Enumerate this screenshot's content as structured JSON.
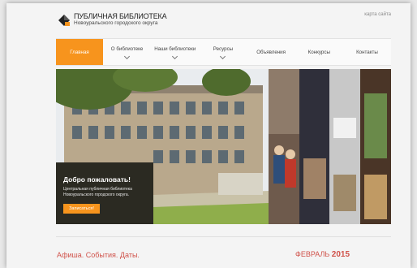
{
  "header": {
    "title": "ПУБЛИЧНАЯ БИБЛИОТЕКА",
    "subtitle": "Новоуральского городского округа",
    "sitemap_link": "карта сайта"
  },
  "nav": {
    "items": [
      {
        "label": "Главная",
        "active": true,
        "dropdown": false
      },
      {
        "label": "О библиотеке",
        "active": false,
        "dropdown": true
      },
      {
        "label": "Наши библиотеки",
        "active": false,
        "dropdown": true
      },
      {
        "label": "Ресурсы",
        "active": false,
        "dropdown": true
      },
      {
        "label": "Объявления",
        "active": false,
        "dropdown": false
      },
      {
        "label": "Конкурсы",
        "active": false,
        "dropdown": false
      },
      {
        "label": "Контакты",
        "active": false,
        "dropdown": false
      }
    ]
  },
  "hero": {
    "welcome_title": "Добро пожаловать!",
    "welcome_text": "Центральная публичная библиотека Новоуральского городского округа.",
    "register_button": "Записаться!"
  },
  "events": {
    "heading": "Афиша. События. Даты.",
    "month": "ФЕВРАЛЬ",
    "year": "2015"
  },
  "colors": {
    "accent": "#f7941d",
    "heading_red": "#d0524a"
  }
}
